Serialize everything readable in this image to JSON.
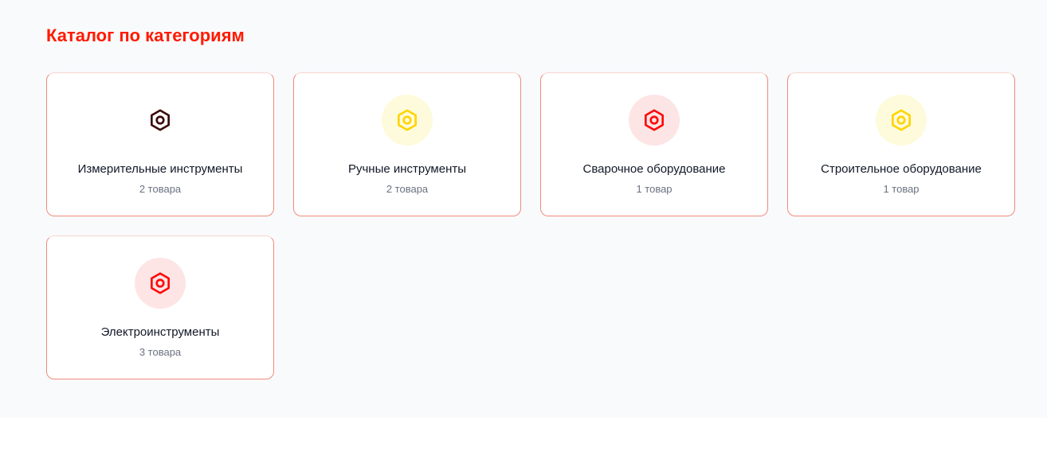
{
  "catalog": {
    "title": "Каталог по категориям",
    "categories": [
      {
        "name": "Измерительные инструменты",
        "count": "2 товара",
        "icon": "hex-nut-icon",
        "icon_color": "#3b0a0a",
        "icon_bg": "#ffffff"
      },
      {
        "name": "Ручные инструменты",
        "count": "2 товара",
        "icon": "hex-nut-icon",
        "icon_color": "#ffd400",
        "icon_bg": "#fefbdc"
      },
      {
        "name": "Сварочное оборудование",
        "count": "1 товар",
        "icon": "hex-nut-icon",
        "icon_color": "#ff0a0a",
        "icon_bg": "#fde5e5"
      },
      {
        "name": "Строительное оборудование",
        "count": "1 товар",
        "icon": "hex-nut-icon",
        "icon_color": "#ffd400",
        "icon_bg": "#fefbdc"
      },
      {
        "name": "Электроинструменты",
        "count": "3 товара",
        "icon": "hex-nut-icon",
        "icon_color": "#ff0a0a",
        "icon_bg": "#fde5e5"
      }
    ]
  }
}
